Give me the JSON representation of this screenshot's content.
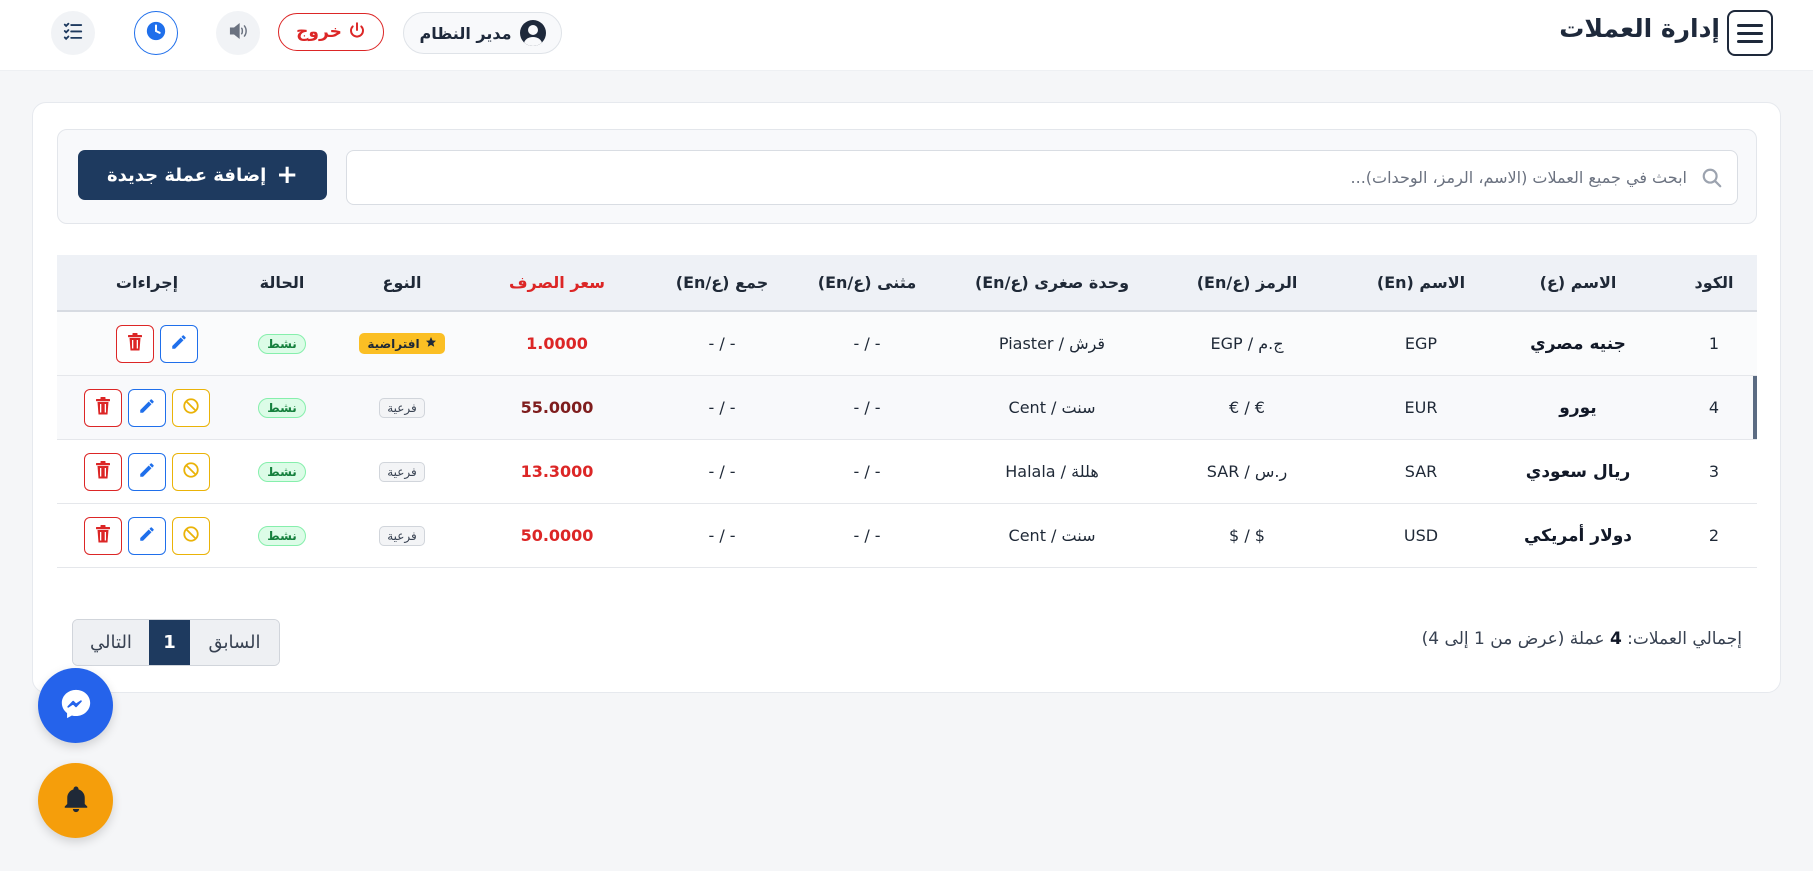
{
  "header": {
    "title": "إدارة العملات",
    "user_label": "مدير النظام",
    "logout_label": "خروج"
  },
  "toolbar": {
    "add_label": "إضافة عملة جديدة",
    "search_placeholder": "ابحث في جميع العملات (الاسم، الرمز، الوحدات)..."
  },
  "table": {
    "headers": {
      "code": "الكود",
      "name_ar": "الاسم (ع)",
      "name_en": "الاسم (En)",
      "symbol": "الرمز (ع/En)",
      "subunit": "وحدة صغرى (ع/En)",
      "hundredth": "مثنى (ع/En)",
      "plural": "جمع (ع/En)",
      "rate": "سعر الصرف",
      "type": "النوع",
      "status": "الحالة",
      "actions": "إجراءات"
    },
    "rows": [
      {
        "code": "1",
        "name_ar": "جنيه مصري",
        "name_en": "EGP",
        "symbol": "ج.م / EGP",
        "subunit": "قرش / Piaster",
        "hundredth": "- / -",
        "plural": "- / -",
        "rate": "1.0000",
        "type": "افتراضية",
        "status": "نشط"
      },
      {
        "code": "4",
        "name_ar": "يورو",
        "name_en": "EUR",
        "symbol": "€ / €",
        "subunit": "سنت / Cent",
        "hundredth": "- / -",
        "plural": "- / -",
        "rate": "55.0000",
        "type": "فرعية",
        "status": "نشط"
      },
      {
        "code": "3",
        "name_ar": "ريال سعودي",
        "name_en": "SAR",
        "symbol": "ر.س / SAR",
        "subunit": "هللة / Halala",
        "hundredth": "- / -",
        "plural": "- / -",
        "rate": "13.3000",
        "type": "فرعية",
        "status": "نشط"
      },
      {
        "code": "2",
        "name_ar": "دولار أمريكي",
        "name_en": "USD",
        "symbol": "$ / $",
        "subunit": "سنت / Cent",
        "hundredth": "- / -",
        "plural": "- / -",
        "rate": "50.0000",
        "type": "فرعية",
        "status": "نشط"
      }
    ]
  },
  "footer": {
    "total_prefix": "إجمالي العملات: ",
    "total_count": "4",
    "total_suffix": " عملة (عرض من 1 إلى 4)",
    "prev_label": "السابق",
    "current_page": "1",
    "next_label": "التالي"
  },
  "colors": {
    "primary": "#1e3a5f",
    "danger": "#dc2626",
    "info": "#1f6feb",
    "warning": "#eab308",
    "success": "#15803d"
  },
  "icons": [
    "menu-icon",
    "user-avatar-icon",
    "power-icon",
    "speaker-icon",
    "clock-icon",
    "tasks-icon",
    "search-icon",
    "plus-icon",
    "star-icon",
    "trash-icon",
    "pencil-icon",
    "block-icon",
    "messenger-icon",
    "bell-icon"
  ]
}
